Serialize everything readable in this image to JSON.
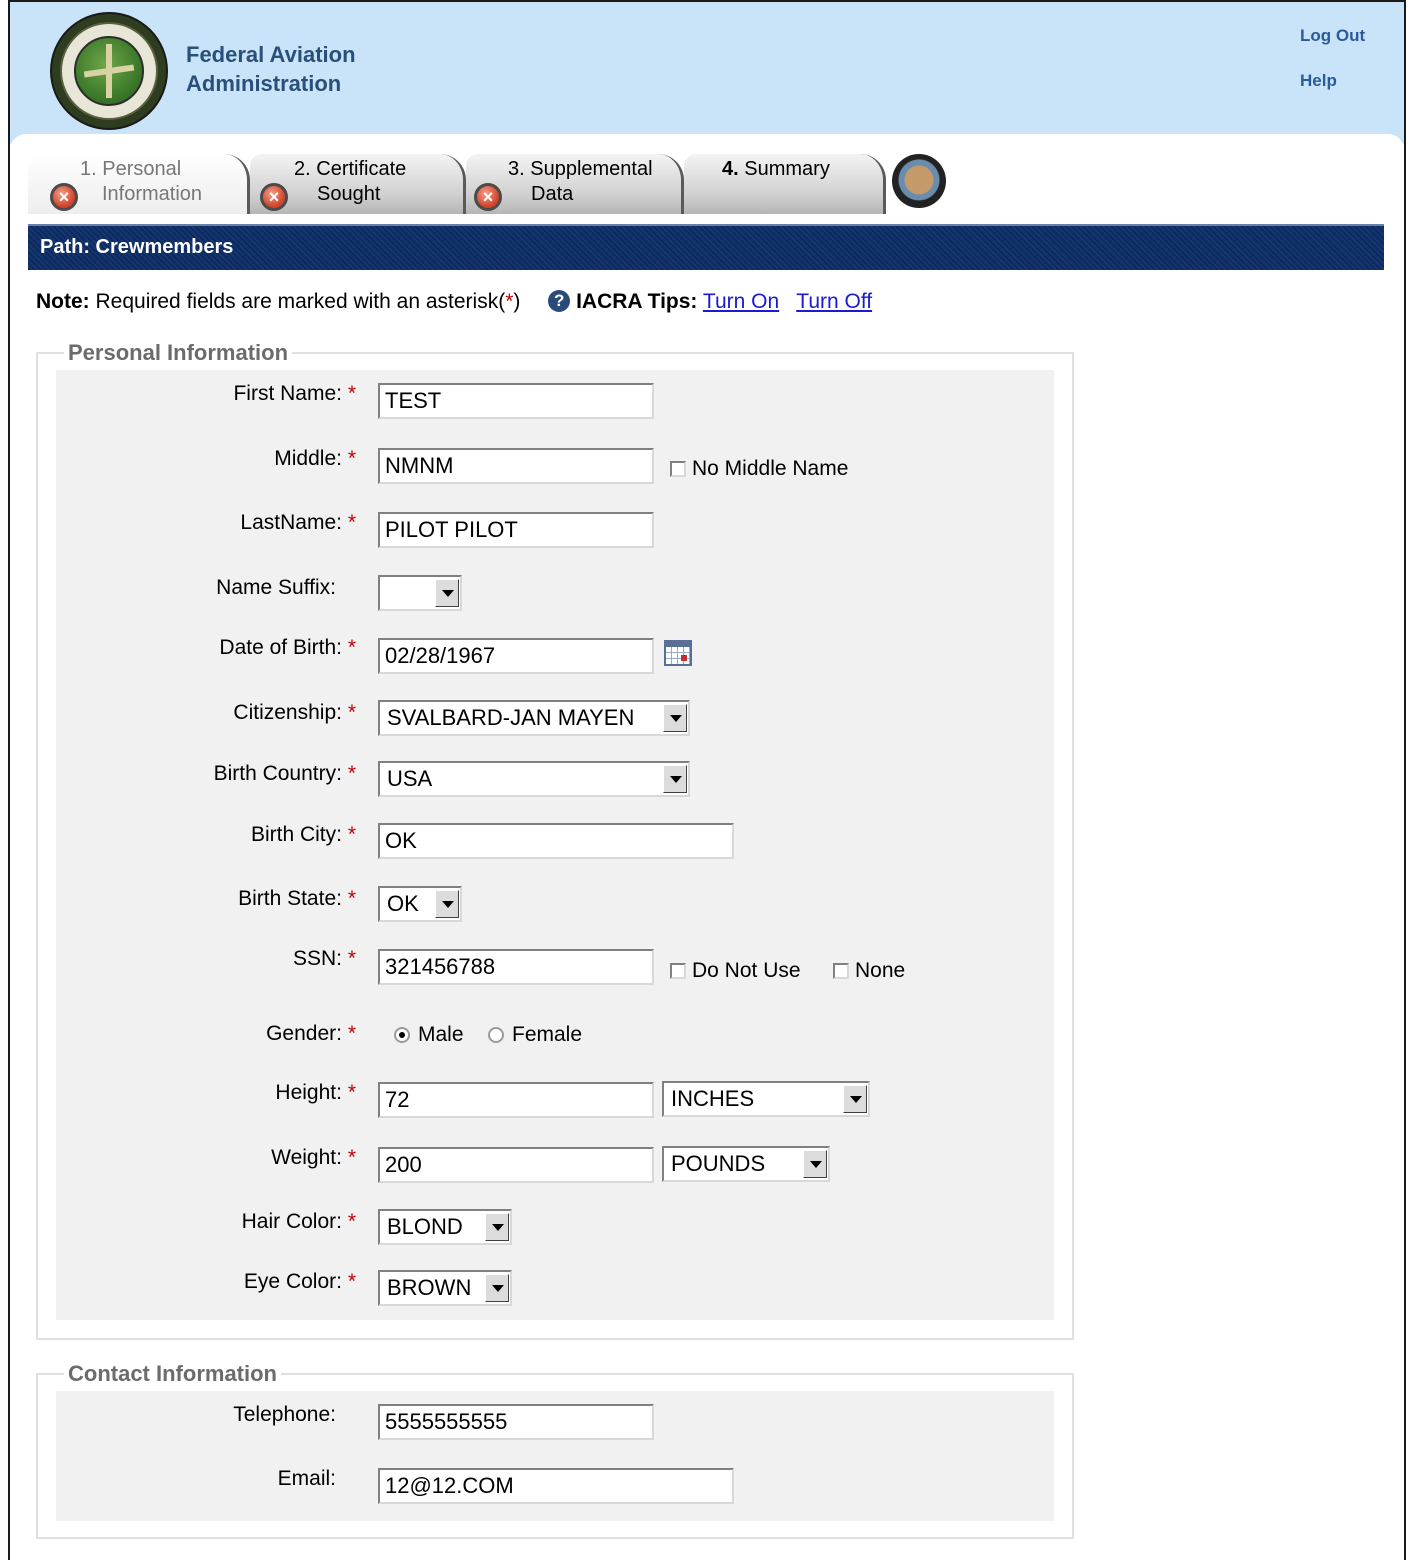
{
  "header": {
    "agency_line1": "Federal Aviation",
    "agency_line2": "Administration",
    "logout": "Log Out",
    "help": "Help"
  },
  "tabs": [
    {
      "num": "1.",
      "line1": "Personal",
      "line2": "Information",
      "state": "active-error"
    },
    {
      "num": "2.",
      "line1": "Certificate",
      "line2": "Sought",
      "state": "error"
    },
    {
      "num": "3.",
      "line1": "Supplemental",
      "line2": "Data",
      "state": "error"
    },
    {
      "num": "4.",
      "line1": "Summary",
      "line2": "",
      "state": "normal"
    }
  ],
  "path": "Path: Crewmembers",
  "note": {
    "label": "Note:",
    "text": "Required fields are marked with an asterisk(",
    "asterisk": "*",
    "close": ")",
    "tips_label": "IACRA Tips:",
    "turn_on": "Turn On",
    "turn_off": "Turn Off"
  },
  "personal": {
    "legend": "Personal Information",
    "first_name_label": "First Name:",
    "first_name": "TEST",
    "middle_label": "Middle:",
    "middle": "NMNM",
    "no_middle": "No Middle Name",
    "last_name_label": "LastName:",
    "last_name": "PILOT PILOT",
    "suffix_label": "Name Suffix:",
    "suffix": "",
    "dob_label": "Date of Birth:",
    "dob": "02/28/1967",
    "citizenship_label": "Citizenship:",
    "citizenship": "SVALBARD-JAN MAYEN",
    "birth_country_label": "Birth Country:",
    "birth_country": "USA",
    "birth_city_label": "Birth City:",
    "birth_city": "OK",
    "birth_state_label": "Birth State:",
    "birth_state": "OK",
    "ssn_label": "SSN:",
    "ssn": "321456788",
    "do_not_use": "Do Not Use",
    "none": "None",
    "gender_label": "Gender:",
    "male": "Male",
    "female": "Female",
    "gender_selected": "Male",
    "height_label": "Height:",
    "height": "72",
    "height_unit": "INCHES",
    "weight_label": "Weight:",
    "weight": "200",
    "weight_unit": "POUNDS",
    "hair_label": "Hair Color:",
    "hair": "BLOND",
    "eye_label": "Eye Color:",
    "eye": "BROWN",
    "required_mark": "*"
  },
  "contact": {
    "legend": "Contact Information",
    "phone_label": "Telephone:",
    "phone": "5555555555",
    "email_label": "Email:",
    "email": "12@12.COM"
  }
}
